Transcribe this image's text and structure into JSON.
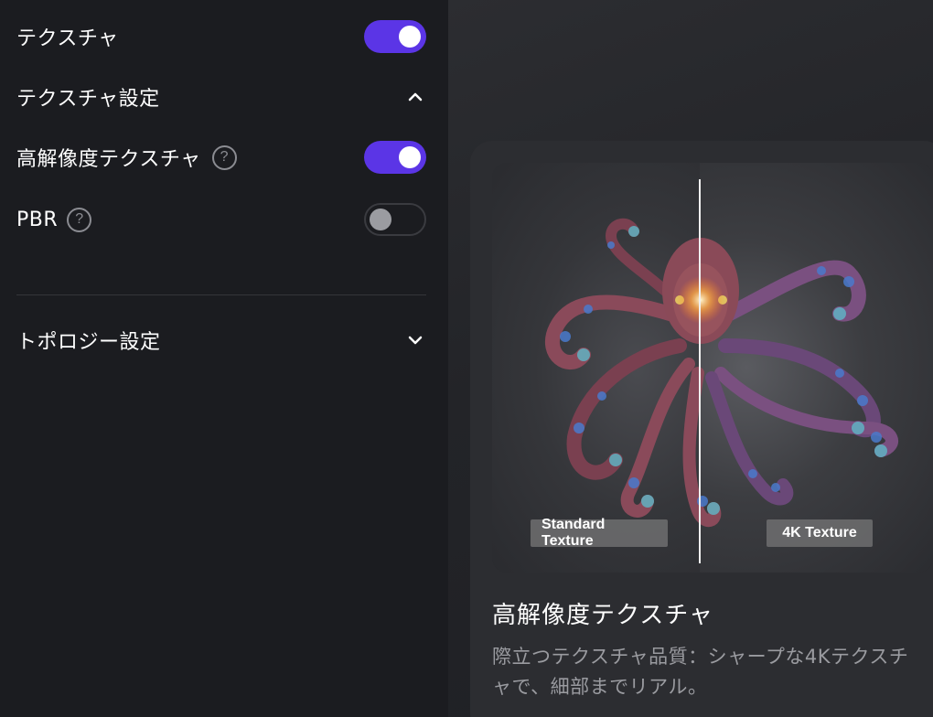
{
  "settings": {
    "texture": {
      "label": "テクスチャ",
      "enabled": true
    },
    "texture_settings": {
      "label": "テクスチャ設定",
      "expanded": true
    },
    "hd_texture": {
      "label": "高解像度テクスチャ",
      "help": "?",
      "enabled": true
    },
    "pbr": {
      "label": "PBR",
      "help": "?",
      "enabled": false
    },
    "topology_settings": {
      "label": "トポロジー設定",
      "expanded": false
    }
  },
  "preview_card": {
    "left_tag": "Standard Texture",
    "right_tag": "4K Texture",
    "title": "高解像度テクスチャ",
    "description": "際立つテクスチャ品質：シャープな4Kテクスチャで、細部までリアル。"
  },
  "colors": {
    "accent": "#5b35e6",
    "panel_bg": "#1b1c20",
    "card_bg": "#2c2d31",
    "muted_text": "#9a9ba0"
  },
  "icons": {
    "help": "question-circle-icon",
    "collapse": "chevron-up-icon",
    "expand": "chevron-down-icon"
  }
}
